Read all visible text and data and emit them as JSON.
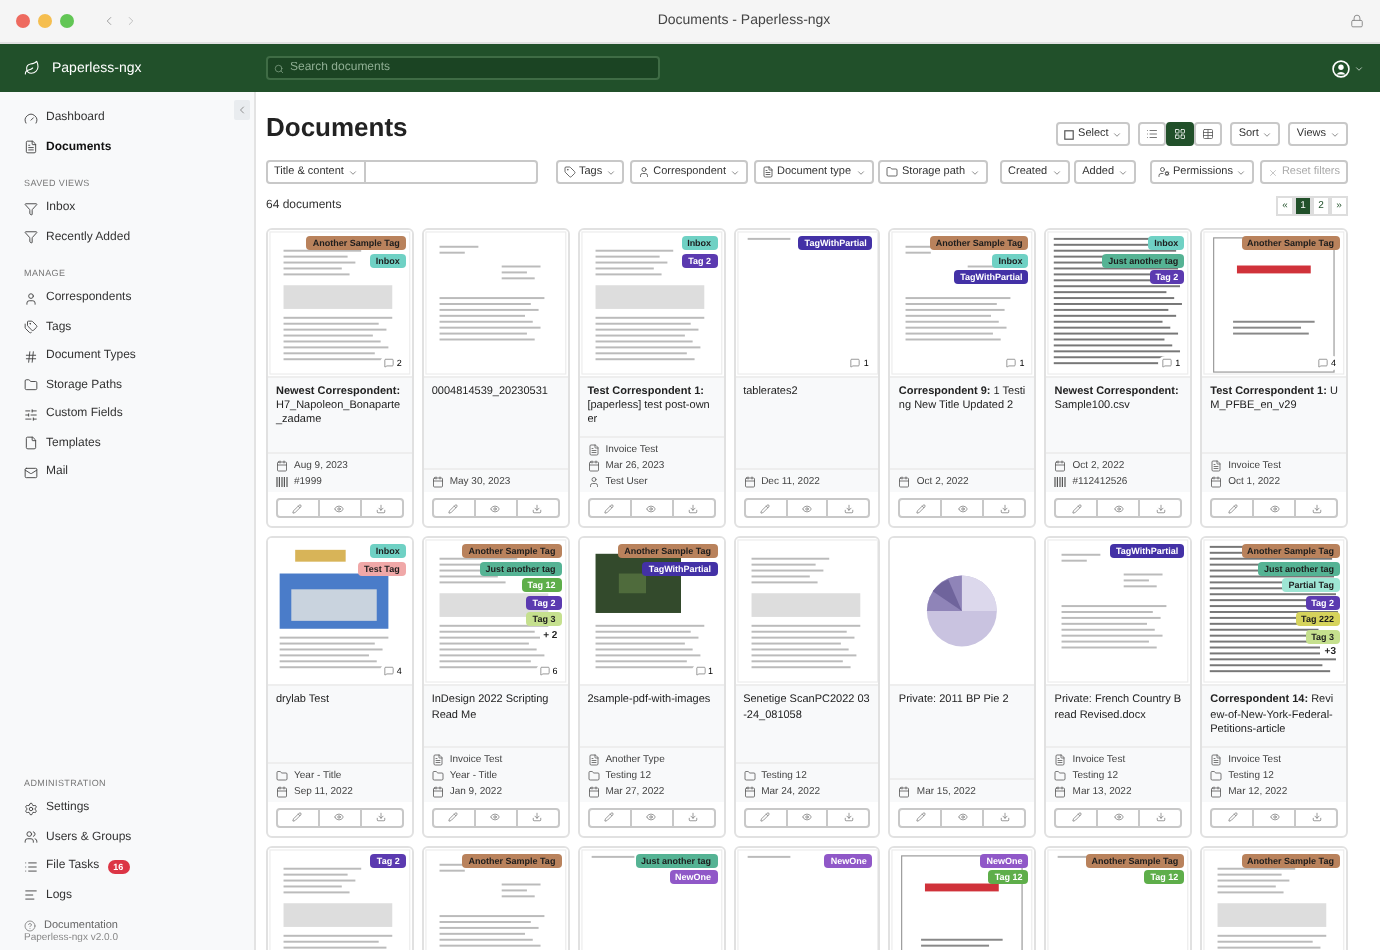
{
  "window": {
    "title": "Documents - Paperless-ngx"
  },
  "header": {
    "app_name": "Paperless-ngx",
    "search": {
      "placeholder": "Search documents"
    }
  },
  "sidebar": {
    "groups": [
      {
        "items": [
          {
            "label": "Dashboard",
            "selected": false
          },
          {
            "label": "Documents",
            "selected": true
          }
        ]
      },
      {
        "heading": "SAVED VIEWS",
        "items": [
          {
            "label": "Inbox",
            "selected": false
          },
          {
            "label": "Recently Added",
            "selected": false
          }
        ]
      },
      {
        "heading": "MANAGE",
        "items": [
          {
            "label": "Correspondents",
            "selected": false
          },
          {
            "label": "Tags",
            "selected": false
          },
          {
            "label": "Document Types",
            "selected": false
          },
          {
            "label": "Storage Paths",
            "selected": false
          },
          {
            "label": "Custom Fields",
            "selected": false
          },
          {
            "label": "Templates",
            "selected": false
          },
          {
            "label": "Mail",
            "selected": false
          }
        ]
      }
    ],
    "admin": {
      "heading": "ADMINISTRATION",
      "items": [
        {
          "label": "Settings",
          "selected": false
        },
        {
          "label": "Users & Groups",
          "selected": false
        },
        {
          "label": "File Tasks",
          "selected": false,
          "badge": "16"
        },
        {
          "label": "Logs",
          "selected": false
        }
      ]
    },
    "footer": {
      "link": "Documentation",
      "version": "Paperless-ngx v2.0.0"
    }
  },
  "toolbar": {
    "title": "Documents",
    "select_button": "Select",
    "view_modes": [
      {
        "selected": false
      },
      {
        "selected": true
      },
      {
        "selected": false
      }
    ],
    "sort_button": "Sort",
    "views_button": "Views"
  },
  "filters": {
    "text_mode": "Title & content",
    "dropdowns": [
      "Tags",
      "Correspondent",
      "Document type",
      "Storage path",
      "Created",
      "Added",
      "Permissions"
    ],
    "reset": {
      "label": "Reset filters",
      "disabled": true
    }
  },
  "count": "64 documents",
  "pagination": [
    {
      "label": "«",
      "selected": false
    },
    {
      "label": "1",
      "selected": true
    },
    {
      "label": "2",
      "selected": false
    },
    {
      "label": "»",
      "selected": false
    }
  ],
  "cards": [
    {
      "kind": "text",
      "tags": [
        {
          "label": "Another Sample Tag",
          "color": "#b9825c"
        },
        {
          "label": "Inbox",
          "color": "#6fd1c4"
        }
      ],
      "notes": "2",
      "correspondent": "Newest Correspondent:",
      "title": "H7_Napoleon_Bonaparte_zadame",
      "meta": [
        {
          "kind": "date",
          "text": "Aug 9, 2023"
        },
        {
          "kind": "asn",
          "text": "#1999"
        }
      ]
    },
    {
      "kind": "letter",
      "title": "0004814539_20230531",
      "meta": [
        {
          "kind": "date",
          "text": "May 30, 2023"
        }
      ]
    },
    {
      "kind": "text",
      "tags": [
        {
          "label": "Inbox",
          "color": "#6fd1c4"
        },
        {
          "label": "Tag 2",
          "color": "#5b3ab0"
        }
      ],
      "correspondent": "Test Correspondent 1:",
      "title": "[paperless] test post-owner",
      "meta": [
        {
          "kind": "type",
          "text": "Invoice Test"
        },
        {
          "kind": "date",
          "text": "Mar 26, 2023"
        },
        {
          "kind": "owner",
          "text": "Test User"
        }
      ]
    },
    {
      "kind": "blank",
      "tags": [
        {
          "label": "TagWithPartial",
          "color": "#4331a6"
        }
      ],
      "notes": "1",
      "title": "tablerates2",
      "meta": [
        {
          "kind": "date",
          "text": "Dec 11, 2022"
        }
      ]
    },
    {
      "kind": "letter",
      "tags": [
        {
          "label": "Another Sample Tag",
          "color": "#b9825c"
        },
        {
          "label": "Inbox",
          "color": "#6fd1c4"
        },
        {
          "label": "TagWithPartial",
          "color": "#4331a6"
        }
      ],
      "notes": "1",
      "correspondent": "Correspondent 9:",
      "title": "1 Testing New Title Updated 2",
      "meta": [
        {
          "kind": "date",
          "text": "Oct 2, 2022"
        }
      ]
    },
    {
      "kind": "dense",
      "tags": [
        {
          "label": "Inbox",
          "color": "#6fd1c4"
        },
        {
          "label": "Just another tag",
          "color": "#55b394"
        },
        {
          "label": "Tag 2",
          "color": "#5b3ab0"
        }
      ],
      "notes": "1",
      "correspondent": "Newest Correspondent:",
      "title": "Sample100.csv",
      "meta": [
        {
          "kind": "date",
          "text": "Oct 2, 2022"
        },
        {
          "kind": "asn",
          "text": "#112412526"
        }
      ]
    },
    {
      "kind": "cover",
      "tags": [
        {
          "label": "Another Sample Tag",
          "color": "#b9825c"
        }
      ],
      "notes": "4",
      "correspondent": "Test Correspondent 1:",
      "title": "UM_PFBE_en_v29",
      "meta": [
        {
          "kind": "type",
          "text": "Invoice Test"
        },
        {
          "kind": "date",
          "text": "Oct 1, 2022"
        }
      ]
    },
    {
      "kind": "photo",
      "tags": [
        {
          "label": "Inbox",
          "color": "#6fd1c4"
        },
        {
          "label": "Test Tag",
          "color": "#f0a8a8"
        }
      ],
      "notes": "4",
      "title": "drylab Test",
      "meta": [
        {
          "kind": "path",
          "text": "Year - Title"
        },
        {
          "kind": "date",
          "text": "Sep 11, 2022"
        }
      ]
    },
    {
      "kind": "text",
      "tags": [
        {
          "label": "Another Sample Tag",
          "color": "#b9825c"
        },
        {
          "label": "Just another tag",
          "color": "#55b394"
        },
        {
          "label": "Tag 12",
          "color": "#5eae4a"
        },
        {
          "label": "Tag 2",
          "color": "#5b3ab0"
        },
        {
          "label": "Tag 3",
          "color": "#c5e08e"
        }
      ],
      "more_tags": "+ 2",
      "notes": "6",
      "title": "InDesign 2022 Scripting Read Me",
      "meta": [
        {
          "kind": "type",
          "text": "Invoice Test"
        },
        {
          "kind": "path",
          "text": "Year - Title"
        },
        {
          "kind": "date",
          "text": "Jan 9, 2022"
        }
      ]
    },
    {
      "kind": "map",
      "tags": [
        {
          "label": "Another Sample Tag",
          "color": "#b9825c"
        },
        {
          "label": "TagWithPartial",
          "color": "#4331a6"
        }
      ],
      "notes": "1",
      "title": "2sample-pdf-with-images",
      "meta": [
        {
          "kind": "type",
          "text": "Another Type"
        },
        {
          "kind": "path",
          "text": "Testing 12"
        },
        {
          "kind": "date",
          "text": "Mar 27, 2022"
        }
      ]
    },
    {
      "kind": "text",
      "title": "Senetige ScanPC2022 03-24_081058",
      "meta": [
        {
          "kind": "path",
          "text": "Testing 12"
        },
        {
          "kind": "date",
          "text": "Mar 24, 2022"
        }
      ]
    },
    {
      "kind": "pie",
      "title": "Private: 2011 BP Pie 2",
      "meta": [
        {
          "kind": "date",
          "text": "Mar 15, 2022"
        }
      ]
    },
    {
      "kind": "letter",
      "tags": [
        {
          "label": "TagWithPartial",
          "color": "#4331a6"
        }
      ],
      "title": "Private: French Country Bread Revised.docx",
      "meta": [
        {
          "kind": "type",
          "text": "Invoice Test"
        },
        {
          "kind": "path",
          "text": "Testing 12"
        },
        {
          "kind": "date",
          "text": "Mar 13, 2022"
        }
      ]
    },
    {
      "kind": "dense",
      "tags": [
        {
          "label": "Another Sample Tag",
          "color": "#b9825c"
        },
        {
          "label": "Just another tag",
          "color": "#55b394"
        },
        {
          "label": "Partial Tag",
          "color": "#9ee6d4"
        },
        {
          "label": "Tag 2",
          "color": "#5b3ab0"
        },
        {
          "label": "Tag 222",
          "color": "#d6d35c"
        },
        {
          "label": "Tag 3",
          "color": "#c5e08e"
        }
      ],
      "more_tags": "+3",
      "correspondent": "Correspondent 14:",
      "title": "Review-of-New-York-Federal-Petitions-article",
      "meta": [
        {
          "kind": "type",
          "text": "Invoice Test"
        },
        {
          "kind": "path",
          "text": "Testing 12"
        },
        {
          "kind": "date",
          "text": "Mar 12, 2022"
        }
      ]
    },
    {
      "kind": "text",
      "tags": [
        {
          "label": "Tag 2",
          "color": "#5b3ab0"
        }
      ]
    },
    {
      "kind": "letter",
      "tags": [
        {
          "label": "Another Sample Tag",
          "color": "#b9825c"
        }
      ]
    },
    {
      "kind": "blank",
      "tags": [
        {
          "label": "Just another tag",
          "color": "#55b394"
        },
        {
          "label": "NewOne",
          "color": "#9058c8"
        }
      ]
    },
    {
      "kind": "blank",
      "tags": [
        {
          "label": "NewOne",
          "color": "#9058c8"
        }
      ]
    },
    {
      "kind": "cover",
      "tags": [
        {
          "label": "NewOne",
          "color": "#9058c8"
        },
        {
          "label": "Tag 12",
          "color": "#5eae4a"
        }
      ]
    },
    {
      "kind": "blank",
      "tags": [
        {
          "label": "Another Sample Tag",
          "color": "#b9825c"
        },
        {
          "label": "Tag 12",
          "color": "#5eae4a"
        }
      ]
    },
    {
      "kind": "text",
      "tags": [
        {
          "label": "Another Sample Tag",
          "color": "#b9825c"
        }
      ]
    }
  ]
}
